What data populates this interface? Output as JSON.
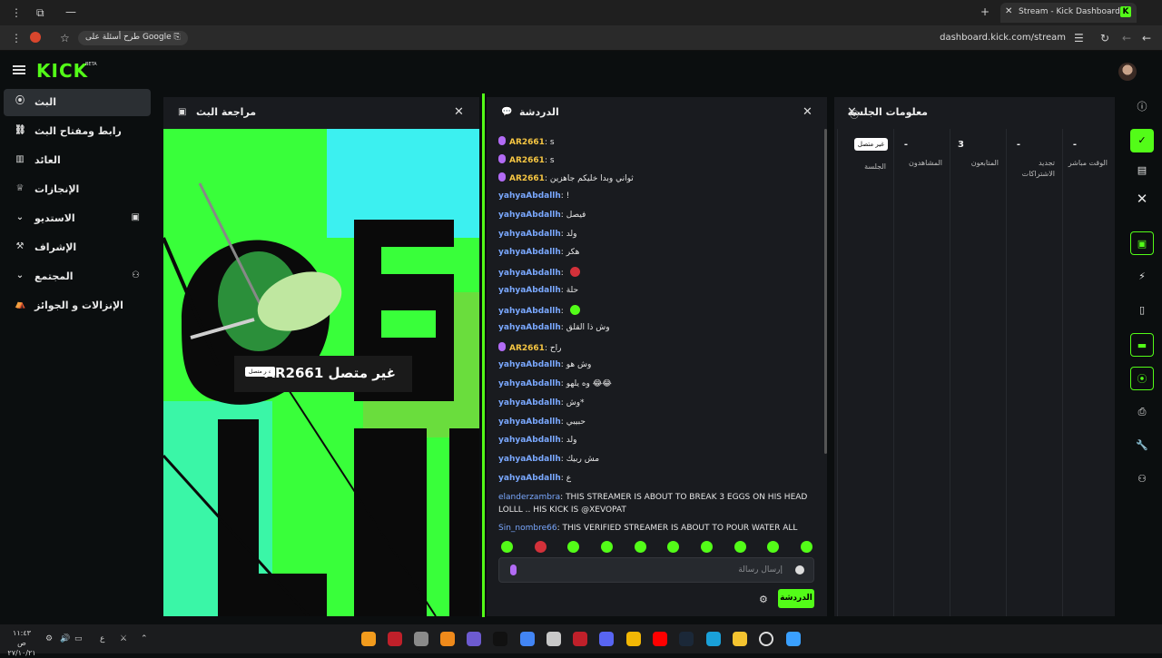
{
  "browser": {
    "tab_title": "Stream - Kick Dashboard",
    "tab_favicon": "K",
    "google_chip": "طرح أسئلة على Google",
    "url": "dashboard.kick.com/stream"
  },
  "header": {
    "logo": "KICK",
    "logo_badge": "BETA"
  },
  "sidebar": {
    "items": [
      {
        "label": "البث",
        "icon": "broadcast-icon"
      },
      {
        "label": "رابط ومفتاح البث",
        "icon": "link-icon"
      },
      {
        "label": "العائد",
        "icon": "chart-icon"
      },
      {
        "label": "الإنجازات",
        "icon": "trophy-icon"
      },
      {
        "label": "الاستديو",
        "icon": "studio-icon"
      },
      {
        "label": "الإشراف",
        "icon": "gavel-icon"
      },
      {
        "label": "المجتمع",
        "icon": "community-icon"
      },
      {
        "label": "الإنزالات و الجوائز",
        "icon": "drops-icon"
      }
    ]
  },
  "preview": {
    "title": "مراجعة البث",
    "offline_title": "AR2661 غير متصل",
    "offline_badge": "غير متصل"
  },
  "chat": {
    "title": "الدردشة",
    "messages": [
      {
        "user": "AR2661",
        "text": "s",
        "color": "gold",
        "mic": true
      },
      {
        "user": "AR2661",
        "text": "s",
        "color": "gold",
        "mic": true
      },
      {
        "user": "AR2661",
        "text": "ثواني وبدا خليكم جاهزين",
        "color": "gold",
        "mic": true
      },
      {
        "user": "yahyaAbdallh",
        "text": "!",
        "color": "blue"
      },
      {
        "user": "yahyaAbdallh",
        "text": "فيصل",
        "color": "blue"
      },
      {
        "user": "yahyaAbdallh",
        "text": "ولد",
        "color": "blue"
      },
      {
        "user": "yahyaAbdallh",
        "text": "هكر",
        "color": "blue"
      },
      {
        "user": "yahyaAbdallh",
        "text": "",
        "color": "blue",
        "emote": "red"
      },
      {
        "user": "yahyaAbdallh",
        "text": "حلة",
        "color": "blue"
      },
      {
        "user": "yahyaAbdallh",
        "text": "",
        "color": "blue",
        "emote": "green"
      },
      {
        "user": "yahyaAbdallh",
        "text": "وش ذا القلق",
        "color": "blue"
      },
      {
        "user": "AR2661",
        "text": "راح",
        "color": "gold",
        "mic": true
      },
      {
        "user": "yahyaAbdallh",
        "text": "وش هو",
        "color": "blue"
      },
      {
        "user": "yahyaAbdallh",
        "text": "وه يلهو 😂😂",
        "color": "blue"
      },
      {
        "user": "yahyaAbdallh",
        "text": "وش*",
        "color": "blue"
      },
      {
        "user": "yahyaAbdallh",
        "text": "حبيبي",
        "color": "blue"
      },
      {
        "user": "yahyaAbdallh",
        "text": "ولد",
        "color": "blue"
      },
      {
        "user": "yahyaAbdallh",
        "text": "مش ربيك",
        "color": "blue"
      },
      {
        "user": "yahyaAbdallh",
        "text": "ع",
        "color": "blue"
      }
    ],
    "long_messages": [
      {
        "user": "elanderzambra",
        "text": "THIS STREAMER IS ABOUT TO BREAK 3 EGGS ON HIS HEAD LOLLL .. HIS KICK IS @XEVOPAT"
      },
      {
        "user": "Sin_nombre66",
        "text": "THIS VERIFIED STREAMER IS ABOUT TO POUR WATER ALL OVER"
      }
    ],
    "input_placeholder": "إرسال رسالة",
    "send_label": "الدردشة"
  },
  "session": {
    "title": "معلومات الجلسة",
    "stats": [
      {
        "value": "",
        "label": "الجلسة",
        "badge": "غير متصل"
      },
      {
        "value": "-",
        "label": "المشاهدون"
      },
      {
        "value": "3",
        "label": "المتابعون"
      },
      {
        "value": "-",
        "label": "تجديد الاشتراكات"
      },
      {
        "value": "-",
        "label": "الوقت مباشر"
      }
    ]
  },
  "taskbar": {
    "time": "١١:٤٣ ص",
    "date": "٢٧/١٠/٢١",
    "lang": "ع"
  },
  "colors": {
    "accent": "#53fc18",
    "panel": "#191b1f",
    "user_blue": "#7aa8ff",
    "user_gold": "#f5c542"
  }
}
